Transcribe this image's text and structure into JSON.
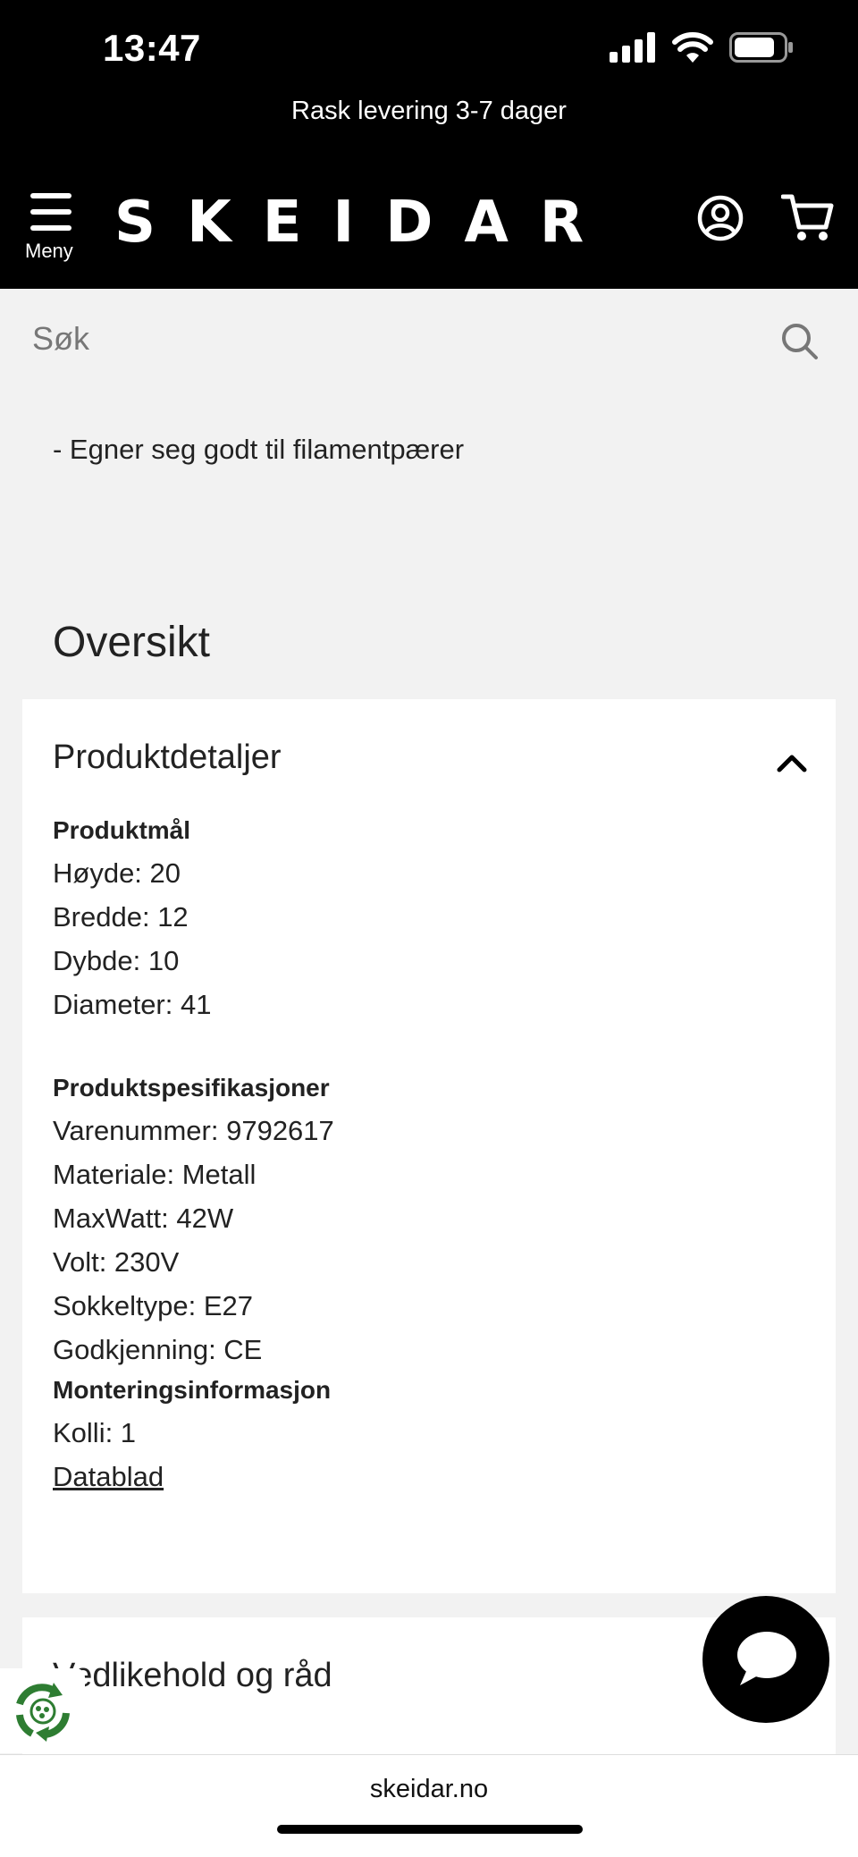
{
  "status": {
    "time": "13:47"
  },
  "promo": {
    "text": "Rask levering 3-7 dager"
  },
  "header": {
    "menu_label": "Meny",
    "logo": "SKEIDAR"
  },
  "search": {
    "placeholder": "Søk"
  },
  "content": {
    "bullet": "- Egner seg godt til filamentpærer",
    "section_title": "Oversikt"
  },
  "details_card": {
    "title": "Produktdetaljer",
    "expanded": true,
    "groups": [
      {
        "heading": "Produktmål",
        "items": [
          "Høyde: 20",
          "Bredde: 12",
          "Dybde: 10",
          "Diameter: 41"
        ]
      },
      {
        "heading": "Produktspesifikasjoner",
        "items": [
          "Varenummer: 9792617",
          "Materiale: Metall",
          "MaxWatt: 42W",
          "Volt: 230V",
          "Sokkeltype: E27",
          "Godkjenning: CE"
        ]
      },
      {
        "heading": "Monteringsinformasjon",
        "items": [
          "Kolli: 1"
        ],
        "link": "Datablad"
      }
    ]
  },
  "maintenance_card": {
    "title": "Vedlikehold og råd"
  },
  "browser": {
    "url": "skeidar.no"
  },
  "colors": {
    "header_bg": "#000000",
    "page_bg": "#f2f2f2",
    "card_bg": "#ffffff",
    "recycle_green": "#2e7d32"
  },
  "icons": [
    "signal-icon",
    "wifi-icon",
    "battery-icon",
    "hamburger-icon",
    "user-icon",
    "cart-icon",
    "search-icon",
    "chevron-up-icon",
    "recycle-icon",
    "chat-icon"
  ]
}
